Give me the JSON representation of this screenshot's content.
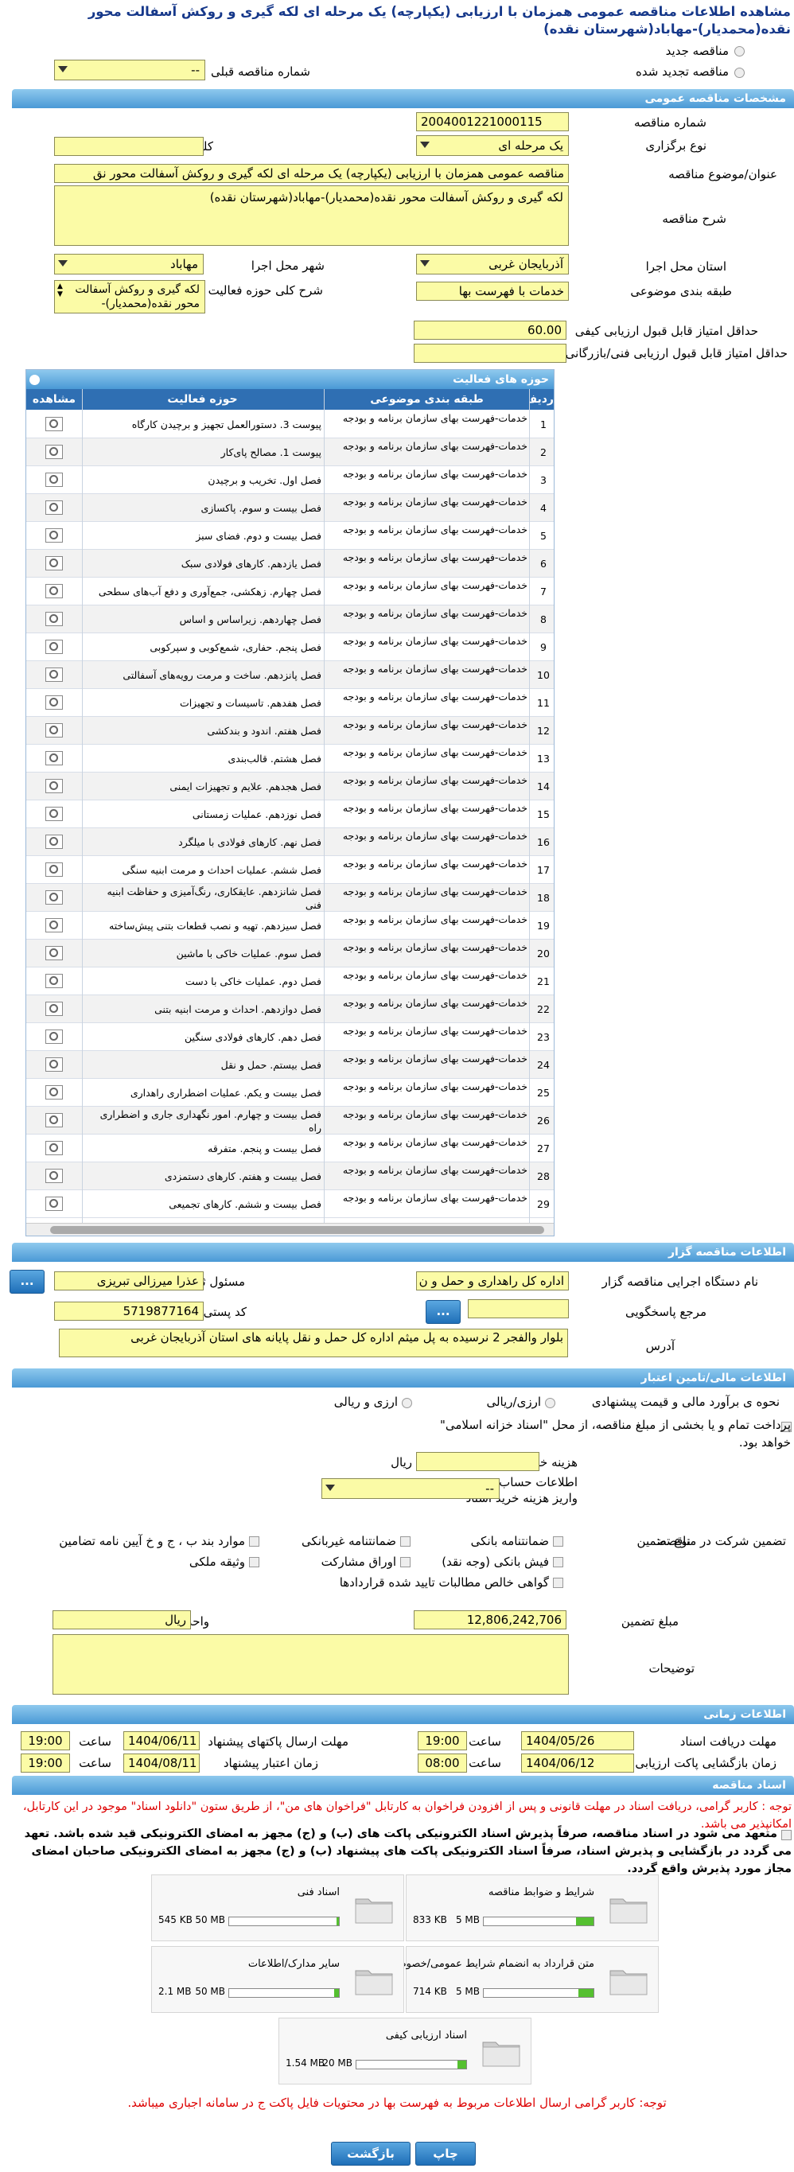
{
  "page": {
    "title": "مشاهده اطلاعات مناقصه عمومی همزمان با ارزیابی (یکپارچه) یک مرحله ای لکه گیری و روکش آسفالت محور نقده(محمدیار)-مهاباد(شهرستان نقده)"
  },
  "top": {
    "new_tender": "مناقصه جدید",
    "renewed_tender": "مناقصه تجدید شده",
    "prev_number_label": "شماره مناقصه قبلی",
    "prev_number_value": "--"
  },
  "general": {
    "section": "مشخصات مناقصه عمومی",
    "number_label": "شماره مناقصه",
    "number_value": "2004001221000115",
    "type_label": "نوع برگزاری",
    "type_value": "یک مرحله ای",
    "keyword_label": "کلید واژه",
    "keyword_value": "",
    "subject_label": "عنوان/موضوع مناقصه",
    "subject_value": "مناقصه عمومی همزمان با ارزیابی (یکپارچه) یک مرحله ای لکه گیری و روکش آسفالت محور نق",
    "desc_label": "شرح مناقصه",
    "desc_value": "لکه گیری و روکش آسفالت محور نقده(محمدیار)-مهاباد(شهرستان نقده)",
    "province_label": "استان محل اجرا",
    "province_value": "آذربایجان غربی",
    "city_label": "شهر محل اجرا",
    "city_value": "مهاباد",
    "category_label": "طبقه بندی موضوعی",
    "category_value": "خدمات با فهرست بها",
    "scope_label": "شرح کلی حوزه فعالیت",
    "scope_value": "لکه گیری و روکش آسفالت محور نقده(محمدیار)-",
    "min_quality_label": "حداقل امتیاز قابل قبول ارزیابی کیفی",
    "min_quality_value": "60.00",
    "min_tech_label": "حداقل امتیاز قابل قبول ارزیابی فنی/بازرگانی",
    "min_tech_value": ""
  },
  "activities": {
    "title": "حوزه های فعالیت",
    "col_idx": "ردیف",
    "col_cat": "طبقه بندی موضوعی",
    "col_act": "حوزه فعالیت",
    "col_view": "مشاهده",
    "category_text": "خدمات-فهرست بهای سازمان برنامه و بودجه",
    "rows": [
      {
        "idx": "1",
        "act": "پیوست 3. دستورالعمل تجهیز و برچیدن کارگاه"
      },
      {
        "idx": "2",
        "act": "پیوست 1. مصالح پای‌کار"
      },
      {
        "idx": "3",
        "act": "فصل اول. تخریب و برچیدن"
      },
      {
        "idx": "4",
        "act": "فصل بیست و سوم. پاکسازی"
      },
      {
        "idx": "5",
        "act": "فصل بیست و دوم. فضای سبز"
      },
      {
        "idx": "6",
        "act": "فصل یازدهم. کارهای فولادی سبک"
      },
      {
        "idx": "7",
        "act": "فصل چهارم. زهکشی، جمع‌آوری و دفع آب‌های سطحی"
      },
      {
        "idx": "8",
        "act": "فصل چهاردهم. زیراساس و اساس"
      },
      {
        "idx": "9",
        "act": "فصل پنجم. حفاری، شمع‌کوبی و سپرکوبی"
      },
      {
        "idx": "10",
        "act": "فصل پانزدهم. ساخت و مرمت رویه‌های آسفالتی"
      },
      {
        "idx": "11",
        "act": "فصل هفدهم. تاسیسات و تجهیزات"
      },
      {
        "idx": "12",
        "act": "فصل هفتم. اندود و بندکشی"
      },
      {
        "idx": "13",
        "act": "فصل هشتم. قالب‌بندی"
      },
      {
        "idx": "14",
        "act": "فصل هجدهم. علایم و تجهیزات ایمنی"
      },
      {
        "idx": "15",
        "act": "فصل نوزدهم. عملیات زمستانی"
      },
      {
        "idx": "16",
        "act": "فصل نهم. کارهای فولادی با میلگرد"
      },
      {
        "idx": "17",
        "act": "فصل ششم. عملیات احداث و مرمت ابنیه سنگی"
      },
      {
        "idx": "18",
        "act": "فصل شانزدهم. عایقکاری، رنگ‌آمیزی و حفاظت ابنیه فنی"
      },
      {
        "idx": "19",
        "act": "فصل سیزدهم. تهیه و نصب قطعات بتنی پیش‌ساخته"
      },
      {
        "idx": "20",
        "act": "فصل سوم. عملیات خاکی با ماشین"
      },
      {
        "idx": "21",
        "act": "فصل دوم. عملیات خاکی با دست"
      },
      {
        "idx": "22",
        "act": "فصل دوازدهم. احداث و مرمت ابنیه بتنی"
      },
      {
        "idx": "23",
        "act": "فصل دهم. کارهای فولادی سنگین"
      },
      {
        "idx": "24",
        "act": "فصل بیستم. حمل و نقل"
      },
      {
        "idx": "25",
        "act": "فصل بیست و یکم. عملیات اضطراری راهداری"
      },
      {
        "idx": "26",
        "act": "فصل بیست و چهارم. امور نگهداری جاری و اضطراری راه"
      },
      {
        "idx": "27",
        "act": "فصل بیست و پنجم. متفرقه"
      },
      {
        "idx": "28",
        "act": "فصل بیست و هفتم. کارهای دستمزدی"
      },
      {
        "idx": "29",
        "act": "فصل بیست و ششم. کارهای تجمیعی"
      }
    ]
  },
  "organizer": {
    "section": "اطلاعات مناقصه گزار",
    "org_label": "نام دستگاه اجرایی مناقصه گزار",
    "org_value": "اداره کل راهداری و حمل و ن",
    "resp_label": "مسئول ثبت مناقصه",
    "resp_value": "عذرا میرزالی تبریزی",
    "resp_btn": "...",
    "ref_label": "مرجع پاسخگویی",
    "ref_value": "",
    "ref_btn": "...",
    "postal_label": "کد پستی",
    "postal_value": "5719877164",
    "address_label": "آدرس",
    "address_value": "بلوار والفجر 2 نرسیده به پل میثم اداره کل حمل و نقل پایانه های استان آذربایجان غربی"
  },
  "finance": {
    "section": "اطلاعات مالی/تامین اعتبار",
    "method_label": "نحوه ی برآورد مالی و قیمت پیشنهادی",
    "opt_rial": "ارزی/ریالی",
    "opt_fx": "ارزی و ریالی",
    "treasury_text": "پرداخت تمام و یا بخشی از مبلغ مناقصه، از محل \"اسناد خزانه اسلامی\" خواهد بود.",
    "fee_label": "هزینه خرید اسناد",
    "fee_unit": "ریال",
    "fee_value": "",
    "acc_label": "اطلاعات حساب جهت واریز هزینه خرید اسناد",
    "acc_value": "--"
  },
  "guarantee": {
    "participation_label": "تضمین شرکت در مناقصه:",
    "type_label": "نوع تضمین",
    "options": [
      "ضمانتنامه بانکی",
      "ضمانتنامه غیربانکی",
      "موارد بند ب ، ج و خ آیین نامه تضامین",
      "فیش بانکی (وجه نقد)",
      "اوراق مشارکت",
      "وثیقه ملکی",
      "گواهی خالص مطالبات تایید شده قراردادها"
    ],
    "amount_label": "مبلغ تضمین",
    "amount_value": "12,806,242,706",
    "unit_label": "واحد پول",
    "unit_value": "ریال",
    "notes_label": "توضیحات",
    "notes_value": ""
  },
  "timing": {
    "section": "اطلاعات زمانی",
    "doc_receive_label": "مهلت دریافت اسناد",
    "doc_receive_date": "1404/05/26",
    "doc_receive_time": "19:00",
    "send_label": "مهلت ارسال پاکتهای پیشنهاد",
    "send_date": "1404/06/11",
    "send_time": "19:00",
    "open_label": "زمان بازگشایی پاکت ارزیابی کیفی",
    "open_date": "1404/06/12",
    "open_time": "08:00",
    "valid_label": "زمان اعتبار پیشنهاد",
    "valid_date": "1404/08/11",
    "valid_time": "19:00",
    "time_label": "ساعت"
  },
  "docs": {
    "section": "اسناد مناقصه",
    "notice": "توجه : کاربر گرامی، دریافت اسناد در مهلت قانونی و پس از افزودن فراخوان به کارتابل \"فراخوان های من\"، از طریق ستون \"دانلود اسناد\" موجود در این کارتابل، امکانپذیر می باشد.",
    "commit": "متعهد می شود در اسناد مناقصه، صرفاً پذیرش اسناد الکترونیکی پاکت های (ب) و (ج) مجهز به امضای الکترونیکی قید شده باشد. تعهد می گردد در بازگشایی و پذیرش اسناد، صرفاً اسناد الکترونیکی پاکت های پیشنهاد (ب) و (ج) مجهز به امضای الکترونیکی صاحبان امضای مجاز مورد پذیرش واقع گردد.",
    "files": [
      {
        "name": "شرایط و ضوابط مناقصه",
        "max": "5 MB",
        "cur": "833 KB",
        "fill": 0.16
      },
      {
        "name": "اسناد فنی",
        "max": "50 MB",
        "cur": "545 KB",
        "fill": 0.02
      },
      {
        "name": "متن قرارداد به انضمام شرایط عمومی/خصوصی",
        "max": "5 MB",
        "cur": "714 KB",
        "fill": 0.14
      },
      {
        "name": "سایر مدارک/اطلاعات",
        "max": "50 MB",
        "cur": "2.1 MB",
        "fill": 0.04
      },
      {
        "name": "اسناد ارزیابی کیفی",
        "max": "20 MB",
        "cur": "1.54 MB",
        "fill": 0.08
      }
    ],
    "footer_note": "توجه: کاربر گرامی ارسال اطلاعات مربوط به فهرست بها در محتویات فایل پاکت ج در سامانه اجباری میباشد."
  },
  "actions": {
    "back": "بازگشت",
    "print": "چاپ"
  },
  "colors": {
    "section_bg": "#4a99d6",
    "field_bg": "#fbfba6",
    "title": "#16388a",
    "red": "#dd0000"
  }
}
